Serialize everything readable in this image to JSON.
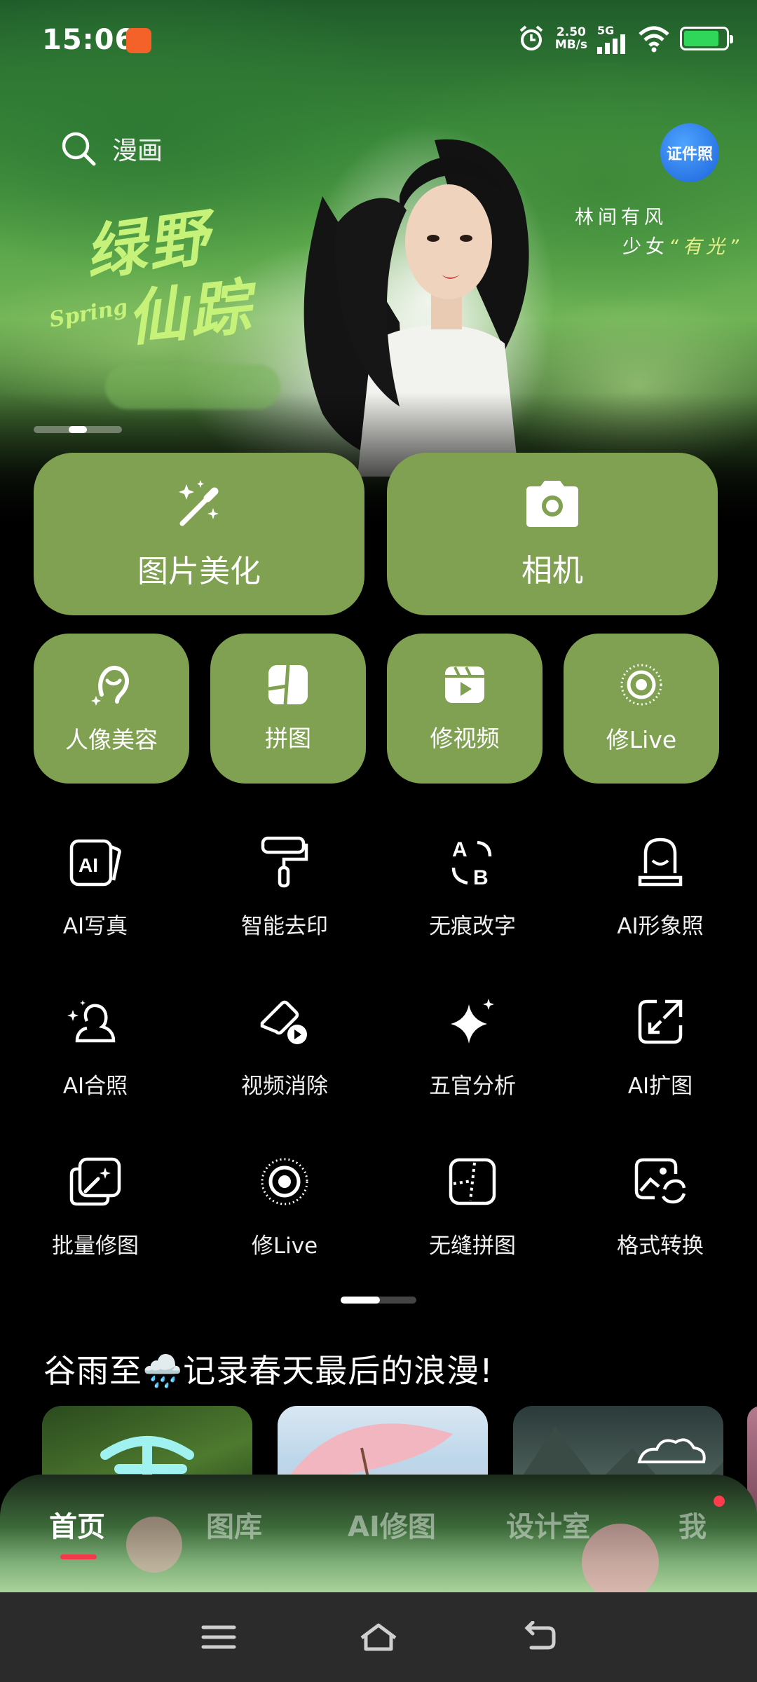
{
  "status_bar": {
    "time": "15:06",
    "speed_value": "2.50",
    "speed_unit": "MB/s",
    "network": "5G",
    "battery_level": 0.85
  },
  "hero": {
    "search_text": "漫画",
    "id_photo_label": "证件照",
    "title_line1": "绿野",
    "title_line2": "仙踪",
    "title_accent": "Spring",
    "slogan_line1": "林间有风",
    "slogan_line2_prefix": "少女",
    "slogan_line2_highlight": "“有光”",
    "banner_count": 3,
    "banner_active": 2
  },
  "main_buttons": [
    {
      "label": "图片美化",
      "icon": "magic-wand-icon"
    },
    {
      "label": "相机",
      "icon": "camera-icon"
    }
  ],
  "secondary_buttons": [
    {
      "label": "人像美容",
      "icon": "portrait-icon"
    },
    {
      "label": "拼图",
      "icon": "collage-icon"
    },
    {
      "label": "修视频",
      "icon": "video-edit-icon"
    },
    {
      "label": "修Live",
      "icon": "live-photo-icon"
    }
  ],
  "tools": [
    {
      "label": "AI写真",
      "icon": "ai-portrait-icon"
    },
    {
      "label": "智能去印",
      "icon": "paint-roller-icon"
    },
    {
      "label": "无痕改字",
      "icon": "text-swap-icon"
    },
    {
      "label": "AI形象照",
      "icon": "ai-avatar-icon"
    },
    {
      "label": "AI合照",
      "icon": "group-photo-icon"
    },
    {
      "label": "视频消除",
      "icon": "video-eraser-icon"
    },
    {
      "label": "五官分析",
      "icon": "sparkle-icon"
    },
    {
      "label": "AI扩图",
      "icon": "expand-image-icon"
    },
    {
      "label": "批量修图",
      "icon": "batch-edit-icon"
    },
    {
      "label": "修Live",
      "icon": "live-photo-icon"
    },
    {
      "label": "无缝拼图",
      "icon": "seamless-collage-icon"
    },
    {
      "label": "格式转换",
      "icon": "format-convert-icon"
    }
  ],
  "section": {
    "title_prefix": "谷雨至",
    "title_emoji": "🌧️",
    "title_suffix": "记录春天最后的浪漫!"
  },
  "cards": [
    {
      "id": "card-1"
    },
    {
      "id": "card-2"
    },
    {
      "id": "card-3"
    },
    {
      "id": "card-4"
    }
  ],
  "tabs": [
    {
      "label": "首页",
      "active": true
    },
    {
      "label": "图库",
      "active": false
    },
    {
      "label": "AI修图",
      "active": false
    },
    {
      "label": "设计室",
      "active": false
    },
    {
      "label": "我",
      "active": false
    }
  ],
  "colors": {
    "accent_green": "#7fa151",
    "tab_active_underline": "#f03a4a",
    "badge_blue": "#1d64dc"
  }
}
